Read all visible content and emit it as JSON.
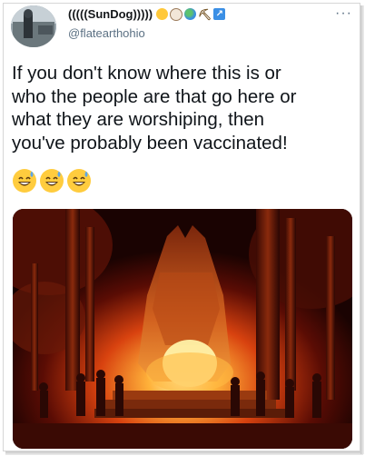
{
  "tweet": {
    "display_name": "(((((SunDog)))))",
    "handle": "@flatearthohio",
    "more_label": "···",
    "text": "If you don't know where this is or\nwho the people are that go here or\nwhat they are worshiping, then\nyou've probably been vaccinated!",
    "name_emojis": [
      "sun-emoji",
      "dog-emoji",
      "globe-emoji",
      "hammer-emoji",
      "arrow-emoji"
    ],
    "reaction_emojis": [
      "grinning-sweat-emoji",
      "grinning-sweat-emoji",
      "grinning-sweat-emoji"
    ]
  },
  "colors": {
    "text": "#0f1419",
    "secondary": "#5b7083",
    "emoji_yellow": "#ffcc3e"
  }
}
